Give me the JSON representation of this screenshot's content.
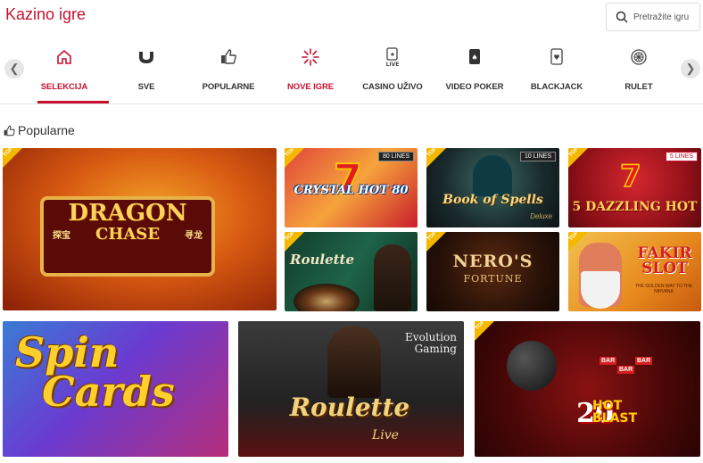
{
  "header": {
    "title": "Kazino igre",
    "search": {
      "placeholder": "Pretražite igru",
      "icon": "search-icon"
    }
  },
  "categories": [
    {
      "label": "SELEKCIJA",
      "icon": "home-icon",
      "active": true
    },
    {
      "label": "SVE",
      "icon": "all-games-icon",
      "active": false
    },
    {
      "label": "POPULARNE",
      "icon": "thumbs-up-icon",
      "active": false
    },
    {
      "label": "NOVE IGRE",
      "icon": "new-burst-icon",
      "active": false
    },
    {
      "label": "CASINO UŽIVO",
      "icon": "live-cards-icon",
      "active": false
    },
    {
      "label": "VIDEO POKER",
      "icon": "poker-card-icon",
      "active": false
    },
    {
      "label": "BLACKJACK",
      "icon": "blackjack-card-icon",
      "active": false
    },
    {
      "label": "RULET",
      "icon": "roulette-wheel-icon",
      "active": false
    }
  ],
  "accent_color": "#c8102e",
  "section": {
    "title": "Popularne",
    "icon": "thumbs-up-icon"
  },
  "badge_text": "TOP",
  "games": {
    "dragon_chase": {
      "line1": "DRAGON",
      "line2": "CHASE",
      "cn_left": "探宝",
      "cn_right": "寻龙"
    },
    "crystal_hot": {
      "title": "CRYSTAL HOT 80",
      "lines": "80 LINES"
    },
    "book_of_spells": {
      "title": "Book of Spells",
      "sub": "Deluxe",
      "lines": "10 LINES"
    },
    "dazzling_hot": {
      "title": "5 DAZZLING HOT",
      "lines": "5 LINES"
    },
    "roulette": {
      "title": "Roulette"
    },
    "neros_fortune": {
      "title": "NERO'S",
      "sub": "FORTUNE"
    },
    "fakir_slot": {
      "title": "FAKIR",
      "title2": "SLOT",
      "sub": "THE GOLDEN WAY TO THE NIRVANA"
    },
    "spin_cards": {
      "line1": "Spin",
      "line2": "Cards"
    },
    "roulette_live": {
      "title": "Roulette",
      "sub": "Live",
      "brand1": "Evolution",
      "brand2": "Gaming"
    },
    "hot_blast": {
      "num": "20",
      "hot": "HOT",
      "blast": "BLAST",
      "bar": "BAR"
    }
  }
}
